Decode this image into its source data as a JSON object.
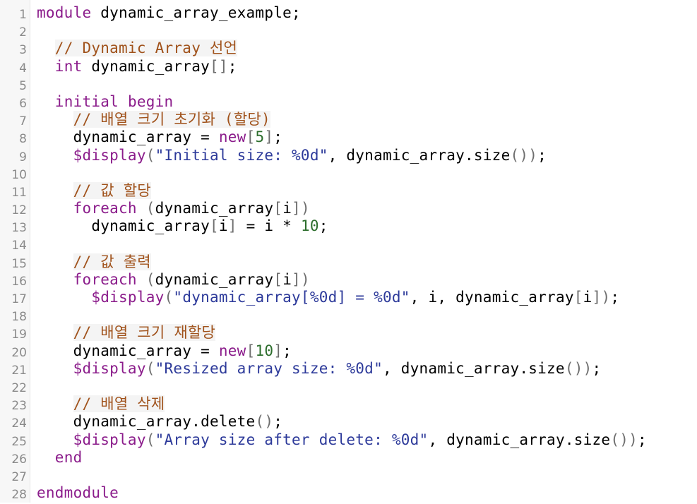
{
  "editor": {
    "lines": [
      {
        "n": "1",
        "tokens": [
          {
            "t": "kw",
            "v": "module"
          },
          {
            "t": "",
            "v": " dynamic_array_example;"
          }
        ]
      },
      {
        "n": "2",
        "tokens": []
      },
      {
        "n": "3",
        "tokens": [
          {
            "t": "",
            "v": "  "
          },
          {
            "t": "cmt",
            "v": "// Dynamic Array 선언"
          }
        ]
      },
      {
        "n": "4",
        "tokens": [
          {
            "t": "",
            "v": "  "
          },
          {
            "t": "kw",
            "v": "int"
          },
          {
            "t": "",
            "v": " dynamic_array"
          },
          {
            "t": "br",
            "v": "[]"
          },
          {
            "t": "",
            "v": ";"
          }
        ]
      },
      {
        "n": "5",
        "tokens": []
      },
      {
        "n": "6",
        "tokens": [
          {
            "t": "",
            "v": "  "
          },
          {
            "t": "kw",
            "v": "initial begin"
          }
        ]
      },
      {
        "n": "7",
        "tokens": [
          {
            "t": "",
            "v": "    "
          },
          {
            "t": "cmt",
            "v": "// 배열 크기 초기화 (할당)"
          }
        ]
      },
      {
        "n": "8",
        "tokens": [
          {
            "t": "",
            "v": "    dynamic_array = "
          },
          {
            "t": "kw",
            "v": "new"
          },
          {
            "t": "br",
            "v": "["
          },
          {
            "t": "num",
            "v": "5"
          },
          {
            "t": "br",
            "v": "]"
          },
          {
            "t": "",
            "v": ";"
          }
        ]
      },
      {
        "n": "9",
        "tokens": [
          {
            "t": "",
            "v": "    "
          },
          {
            "t": "fn",
            "v": "$display"
          },
          {
            "t": "br",
            "v": "("
          },
          {
            "t": "str",
            "v": "\"Initial size: %0d\""
          },
          {
            "t": "",
            "v": ", dynamic_array.size"
          },
          {
            "t": "br",
            "v": "())"
          },
          {
            "t": "",
            "v": ";"
          }
        ]
      },
      {
        "n": "10",
        "tokens": []
      },
      {
        "n": "11",
        "tokens": [
          {
            "t": "",
            "v": "    "
          },
          {
            "t": "cmt",
            "v": "// 값 할당"
          }
        ]
      },
      {
        "n": "12",
        "tokens": [
          {
            "t": "",
            "v": "    "
          },
          {
            "t": "kw",
            "v": "foreach"
          },
          {
            "t": "",
            "v": " "
          },
          {
            "t": "br",
            "v": "("
          },
          {
            "t": "",
            "v": "dynamic_array"
          },
          {
            "t": "br",
            "v": "["
          },
          {
            "t": "",
            "v": "i"
          },
          {
            "t": "br",
            "v": "])"
          }
        ]
      },
      {
        "n": "13",
        "tokens": [
          {
            "t": "",
            "v": "      dynamic_array"
          },
          {
            "t": "br",
            "v": "["
          },
          {
            "t": "",
            "v": "i"
          },
          {
            "t": "br",
            "v": "]"
          },
          {
            "t": "",
            "v": " = i * "
          },
          {
            "t": "num",
            "v": "10"
          },
          {
            "t": "",
            "v": ";"
          }
        ]
      },
      {
        "n": "14",
        "tokens": []
      },
      {
        "n": "15",
        "tokens": [
          {
            "t": "",
            "v": "    "
          },
          {
            "t": "cmt",
            "v": "// 값 출력"
          }
        ]
      },
      {
        "n": "16",
        "tokens": [
          {
            "t": "",
            "v": "    "
          },
          {
            "t": "kw",
            "v": "foreach"
          },
          {
            "t": "",
            "v": " "
          },
          {
            "t": "br",
            "v": "("
          },
          {
            "t": "",
            "v": "dynamic_array"
          },
          {
            "t": "br",
            "v": "["
          },
          {
            "t": "",
            "v": "i"
          },
          {
            "t": "br",
            "v": "])"
          }
        ]
      },
      {
        "n": "17",
        "tokens": [
          {
            "t": "",
            "v": "      "
          },
          {
            "t": "fn",
            "v": "$display"
          },
          {
            "t": "br",
            "v": "("
          },
          {
            "t": "str",
            "v": "\"dynamic_array[%0d] = %0d\""
          },
          {
            "t": "",
            "v": ", i, dynamic_array"
          },
          {
            "t": "br",
            "v": "["
          },
          {
            "t": "",
            "v": "i"
          },
          {
            "t": "br",
            "v": "])"
          },
          {
            "t": "",
            "v": ";"
          }
        ]
      },
      {
        "n": "18",
        "tokens": []
      },
      {
        "n": "19",
        "tokens": [
          {
            "t": "",
            "v": "    "
          },
          {
            "t": "cmt",
            "v": "// 배열 크기 재할당"
          }
        ]
      },
      {
        "n": "20",
        "tokens": [
          {
            "t": "",
            "v": "    dynamic_array = "
          },
          {
            "t": "kw",
            "v": "new"
          },
          {
            "t": "br",
            "v": "["
          },
          {
            "t": "num",
            "v": "10"
          },
          {
            "t": "br",
            "v": "]"
          },
          {
            "t": "",
            "v": ";"
          }
        ]
      },
      {
        "n": "21",
        "tokens": [
          {
            "t": "",
            "v": "    "
          },
          {
            "t": "fn",
            "v": "$display"
          },
          {
            "t": "br",
            "v": "("
          },
          {
            "t": "str",
            "v": "\"Resized array size: %0d\""
          },
          {
            "t": "",
            "v": ", dynamic_array.size"
          },
          {
            "t": "br",
            "v": "())"
          },
          {
            "t": "",
            "v": ";"
          }
        ]
      },
      {
        "n": "22",
        "tokens": []
      },
      {
        "n": "23",
        "tokens": [
          {
            "t": "",
            "v": "    "
          },
          {
            "t": "cmt",
            "v": "// 배열 삭제"
          }
        ]
      },
      {
        "n": "24",
        "tokens": [
          {
            "t": "",
            "v": "    dynamic_array.delete"
          },
          {
            "t": "br",
            "v": "()"
          },
          {
            "t": "",
            "v": ";"
          }
        ]
      },
      {
        "n": "25",
        "tokens": [
          {
            "t": "",
            "v": "    "
          },
          {
            "t": "fn",
            "v": "$display"
          },
          {
            "t": "br",
            "v": "("
          },
          {
            "t": "str",
            "v": "\"Array size after delete: %0d\""
          },
          {
            "t": "",
            "v": ", dynamic_array.size"
          },
          {
            "t": "br",
            "v": "())"
          },
          {
            "t": "",
            "v": ";"
          }
        ]
      },
      {
        "n": "26",
        "tokens": [
          {
            "t": "",
            "v": "  "
          },
          {
            "t": "kw",
            "v": "end"
          }
        ]
      },
      {
        "n": "27",
        "tokens": []
      },
      {
        "n": "28",
        "tokens": [
          {
            "t": "kw",
            "v": "endmodule"
          }
        ]
      }
    ]
  },
  "colors": {
    "keyword": "#8b1c8b",
    "comment": "#a0521b",
    "string": "#2d3a9a",
    "number": "#2d6e2d",
    "bracket": "#6e6e6e",
    "line_number": "#8a8a8a",
    "gutter_bg": "#f7f7f7"
  }
}
